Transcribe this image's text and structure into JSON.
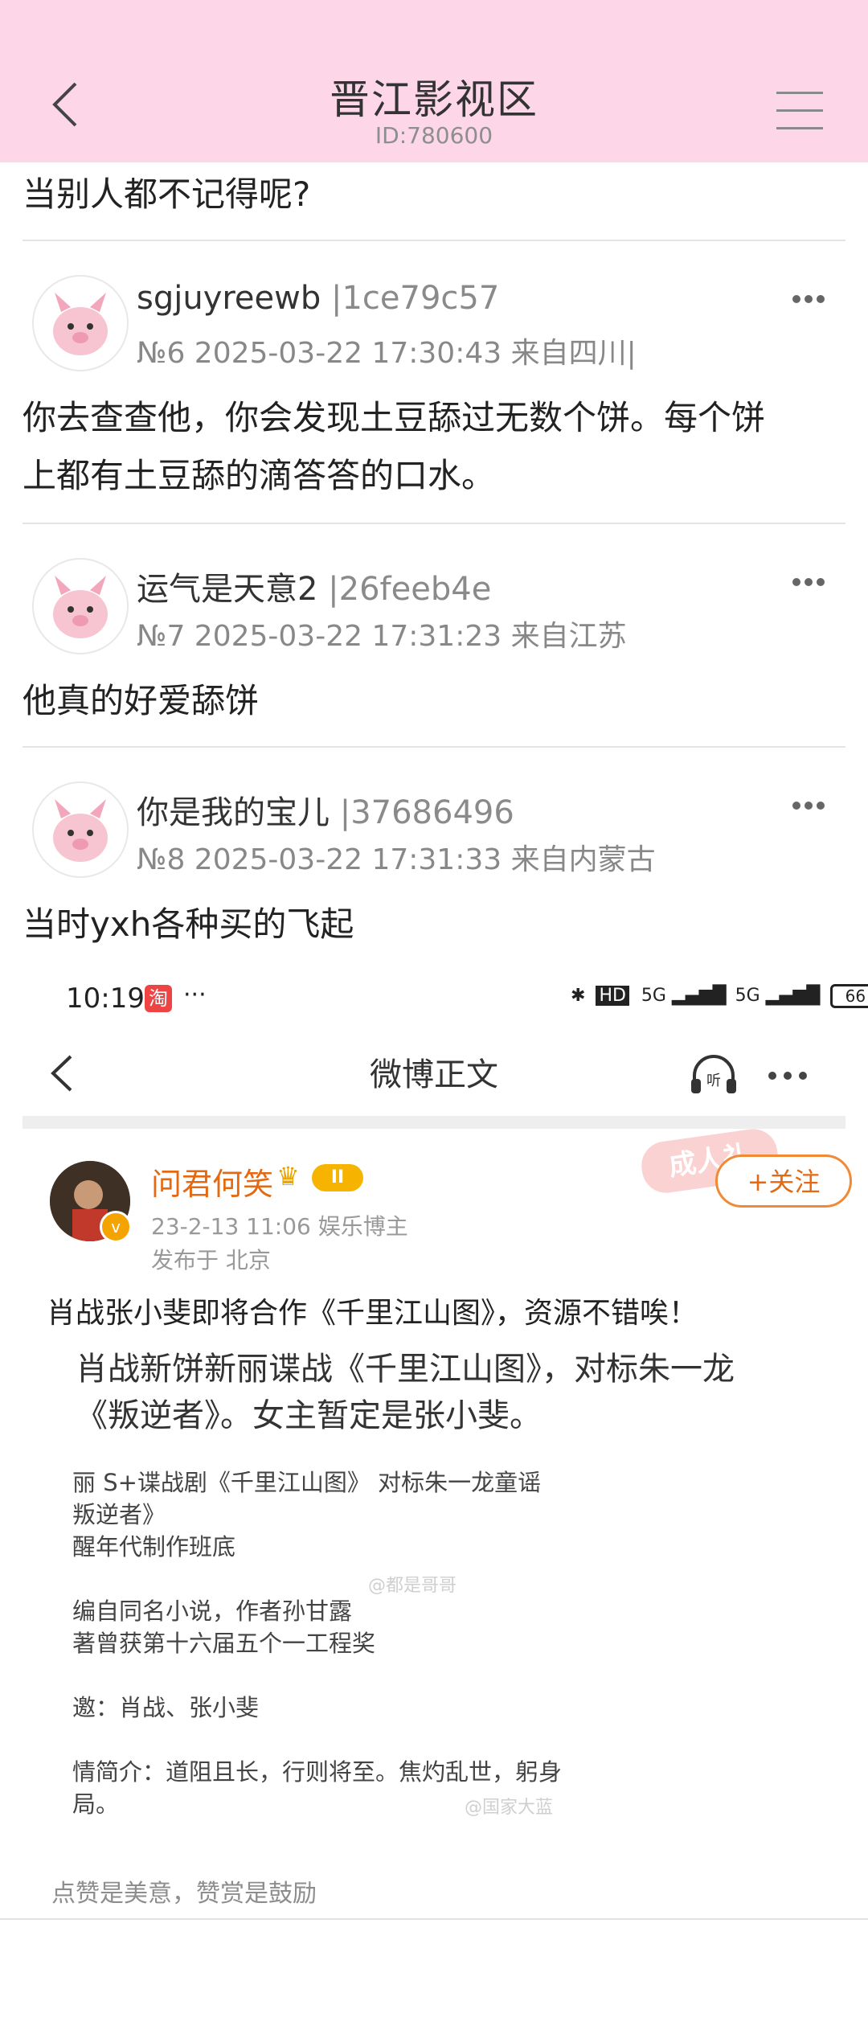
{
  "header": {
    "title": "晋江影视区",
    "id_text": "ID:780600"
  },
  "thread": {
    "partial_text": "当别人都不记得呢?",
    "posts": [
      {
        "username": "sgjuyreewb",
        "hash": "|1ce79c57",
        "meta": "№6 2025-03-22 17:30:43 来自四川|",
        "body_line1": "你去查查他，你会发现土豆舔过无数个饼。每个饼",
        "body_line2": "上都有土豆舔的滴答答的口水。"
      },
      {
        "username": "运气是天意2",
        "hash": "|26feeb4e",
        "meta": "№7 2025-03-22 17:31:23 来自江苏",
        "body_line1": "他真的好爱舔饼"
      },
      {
        "username": "你是我的宝儿",
        "hash": "|37686496",
        "meta": "№8 2025-03-22 17:31:33 来自内蒙古",
        "body_line1": "当时yxh各种买的飞起"
      }
    ]
  },
  "embedded": {
    "status": {
      "time": "10:19",
      "taobao": "淘",
      "dots": "···",
      "hd": "HD",
      "net": "5G",
      "battery": "66"
    },
    "nav": {
      "title": "微博正文",
      "listen": "听"
    },
    "post": {
      "author": "问君何笑",
      "level": "II",
      "meta": "23-2-13 11:06 娱乐博主",
      "location": "发布于 北京",
      "sticker": "成人礼",
      "follow": "+关注",
      "verified": "v",
      "text": "肖战张小斐即将合作《千里江山图》，资源不错唉！",
      "image_big_1": "肖战新饼新丽谍战《千里江山图》，对标朱一龙",
      "image_big_2": "《叛逆者》。女主暂定是张小斐。",
      "image_small_1": "丽 S+谍战剧《千里江山图》 对标朱一龙童谣",
      "image_small_2": "叛逆者》",
      "image_small_3": "醒年代制作班底",
      "image_small_4": "编自同名小说，作者孙甘露",
      "image_small_5": "著曾获第十六届五个一工程奖",
      "image_small_6": "邀：肖战、张小斐",
      "image_small_7": "情简介：道阻且长，行则将至。焦灼乱世，躬身",
      "image_small_8": "局。",
      "watermark_1": "@都是哥哥",
      "watermark_2": "@国家大蓝",
      "footer": "点赞是美意，赞赏是鼓励"
    }
  },
  "colors": {
    "header_bg": "#fdd7e8",
    "weibo_orange": "#e36a12",
    "gold": "#f6b400"
  }
}
